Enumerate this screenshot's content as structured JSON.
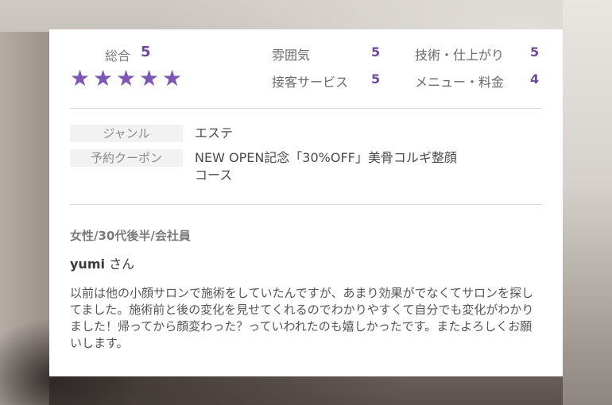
{
  "overall": {
    "label": "総合",
    "value": "5",
    "stars": 5
  },
  "ratings": [
    {
      "label": "雰囲気",
      "value": "5"
    },
    {
      "label": "技術・仕上がり",
      "value": "5"
    },
    {
      "label": "接客サービス",
      "value": "5"
    },
    {
      "label": "メニュー・料金",
      "value": "4"
    }
  ],
  "info": {
    "genre_label": "ジャンル",
    "genre_value": "エステ",
    "coupon_label": "予約クーポン",
    "coupon_line1": "NEW OPEN記念「30%OFF」美骨コルギ整顔",
    "coupon_line2": "コース"
  },
  "reviewer": {
    "meta": "女性/30代後半/会社員",
    "name": "yumi",
    "honorific": "さん"
  },
  "review": {
    "text": "以前は他の小顔サロンで施術をしていたんですが、あまり効果がでなくてサロンを探してました。施術前と後の変化を見せてくれるのでわかりやすくて自分でも変化がわかりました！帰ってから顔変わった？っていわれたのも嬉しかったです。またよろしくお願いします。"
  },
  "colors": {
    "accent": "#7c57b5",
    "score": "#6e4a9e",
    "tag_bg": "#f2f2f2"
  }
}
